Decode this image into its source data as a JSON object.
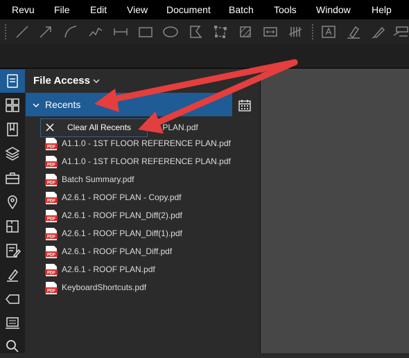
{
  "menu": [
    "Revu",
    "File",
    "Edit",
    "View",
    "Document",
    "Batch",
    "Tools",
    "Window",
    "Help"
  ],
  "panel": {
    "title": "File Access",
    "section": "Recents"
  },
  "context_menu": {
    "label": "Clear All Recents",
    "partial_hidden_text": "NG PLAN.pdf"
  },
  "files": [
    "A1.1.0 - 1ST FLOOR REFERENCE PLAN.pdf",
    "A1.1.0 - 1ST FLOOR REFERENCE PLAN.pdf",
    "Batch Summary.pdf",
    "A2.6.1 - ROOF PLAN - Copy.pdf",
    "A2.6.1 - ROOF PLAN_Diff(2).pdf",
    "A2.6.1 - ROOF PLAN_Diff(1).pdf",
    "A2.6.1 - ROOF PLAN_Diff.pdf",
    "A2.6.1 - ROOF PLAN.pdf",
    "KeyboardShortcuts.pdf"
  ],
  "pdf_icon_text": "PDF",
  "colors": {
    "accent": "#1f5b95",
    "arrow": "#e53e3e",
    "pdf_red": "#d62b2b"
  }
}
